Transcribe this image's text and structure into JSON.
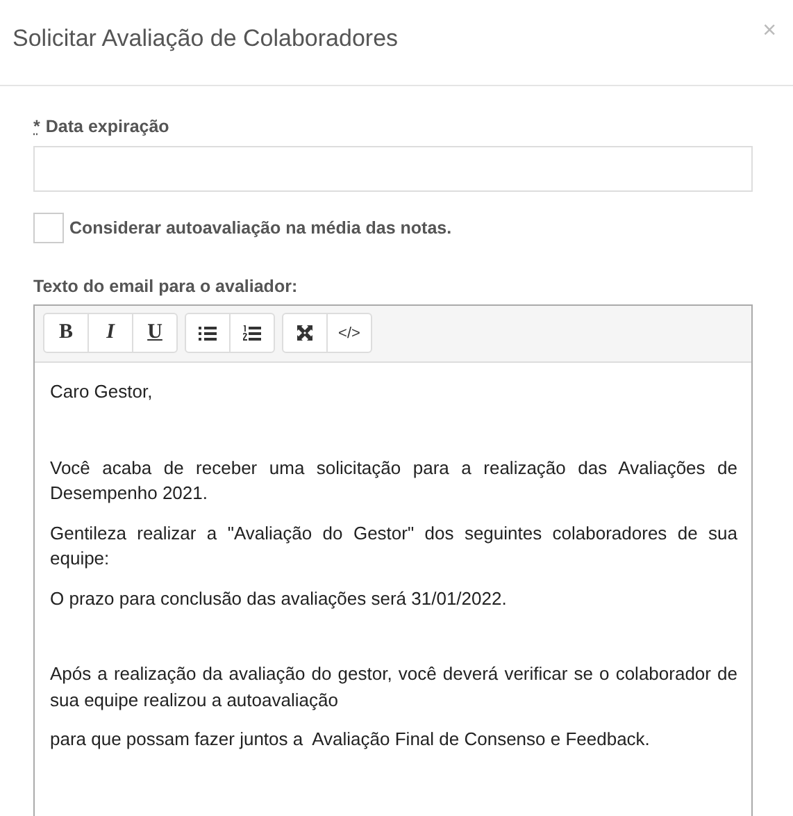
{
  "dialog": {
    "title": "Solicitar Avaliação de Colaboradores",
    "close": "×"
  },
  "expiry_field": {
    "required_mark": "*",
    "label": "Data expiração"
  },
  "consider_self": {
    "label": "Considerar autoavaliação na média das notas.",
    "checked": false
  },
  "email": {
    "label": "Texto do email para o avaliador:",
    "toolbar": [
      [
        {
          "kind": "bold",
          "text": "B"
        },
        {
          "kind": "italic",
          "text": "I"
        },
        {
          "kind": "underline",
          "text": "U"
        }
      ],
      [
        {
          "kind": "bullet-list"
        },
        {
          "kind": "numbered-list"
        }
      ],
      [
        {
          "kind": "fullscreen"
        },
        {
          "kind": "code",
          "text": "</>"
        }
      ]
    ],
    "paragraphs": [
      "Caro Gestor,",
      "Você acaba de receber uma solicitação para a realização das Avaliações de Desempenho 2021.",
      "Gentileza realizar a \"Avaliação do Gestor\" dos seguintes colaboradores de sua equipe:",
      "O prazo para conclusão das avaliações será 31/01/2022.",
      "Após a realização da avaliação do gestor, você deverá verificar se o colaborador de sua equipe realizou a autoavaliação",
      "para que possam fazer juntos a  Avaliação Final de Consenso e Feedback."
    ]
  }
}
